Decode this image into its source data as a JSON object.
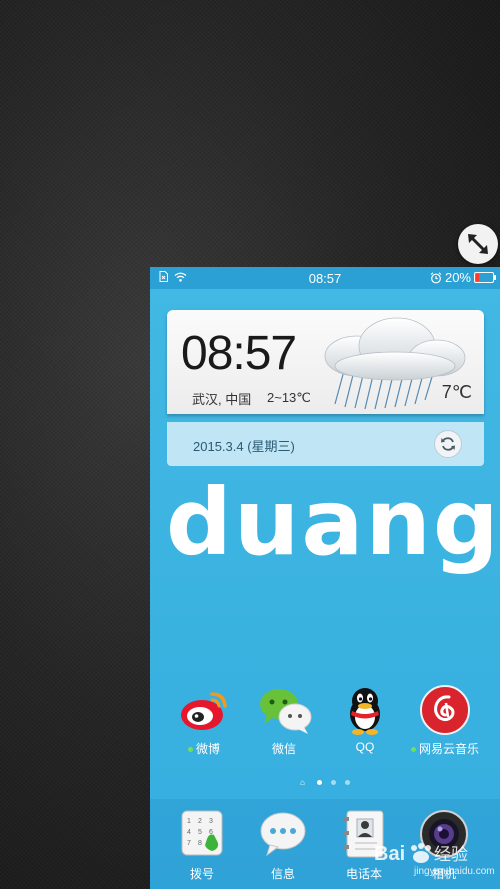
{
  "status": {
    "time": "08:57",
    "battery_text": "20%",
    "battery_level": 0.2,
    "left_icons": [
      "sim-icon",
      "wifi-icon"
    ],
    "right_icons": [
      "alarm-icon",
      "battery-icon"
    ]
  },
  "weather_widget": {
    "clock": "08:57",
    "location": "武汉, 中国",
    "temp_range": "2~13℃",
    "current_temp": "7℃",
    "date": "2015.3.4 (星期三)",
    "icons": [
      "rain-cloud-icon",
      "refresh-icon"
    ]
  },
  "banner_text": "duang",
  "home_apps": [
    {
      "label": "微博",
      "icon": "weibo-icon",
      "new_dot": true
    },
    {
      "label": "微信",
      "icon": "wechat-icon",
      "new_dot": false
    },
    {
      "label": "QQ",
      "icon": "qq-icon",
      "new_dot": false
    },
    {
      "label": "网易云音乐",
      "icon": "netease-music-icon",
      "new_dot": true
    }
  ],
  "pager": {
    "pages": 3,
    "current": 1
  },
  "dock_apps": [
    {
      "label": "拨号",
      "icon": "dialer-icon"
    },
    {
      "label": "信息",
      "icon": "messages-icon"
    },
    {
      "label": "电话本",
      "icon": "contacts-icon"
    },
    {
      "label": "相机",
      "icon": "camera-icon"
    }
  ],
  "watermark": {
    "text": "Bai 经验",
    "sub": "jingyan.baidu.com"
  },
  "colors": {
    "screen_blue": "#3ab2e0",
    "status_bar": "#2aa0d4",
    "battery_low": "#ff3b30"
  }
}
